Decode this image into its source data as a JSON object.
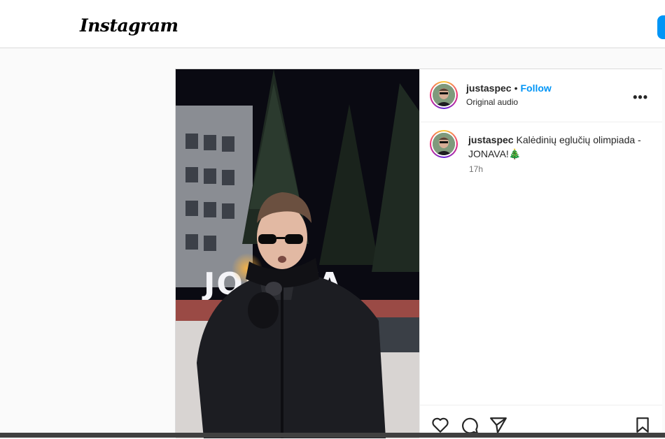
{
  "brand": {
    "logo_text": "Instagram",
    "accent": "#0095f6"
  },
  "post": {
    "author": {
      "username": "justaspec",
      "separator": "•",
      "follow_label": "Follow",
      "audio_label": "Original audio"
    },
    "media": {
      "sign_text": "JONAVA"
    },
    "caption": {
      "username": "justaspec",
      "text": "Kalėdinių eglučių olimpiada - JONAVA!🎄",
      "time": "17h"
    },
    "more_label": "•••",
    "actions": [
      "heart-icon",
      "comment-icon",
      "share-icon",
      "bookmark-icon"
    ]
  }
}
